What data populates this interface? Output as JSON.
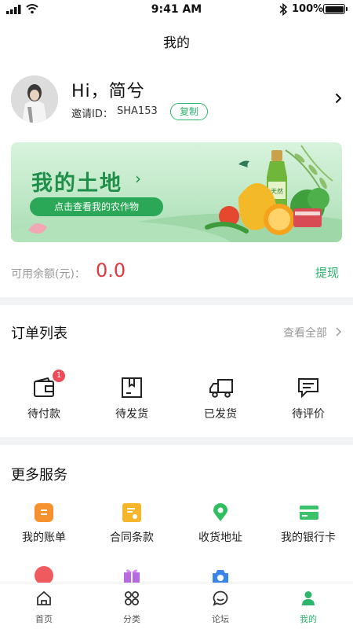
{
  "status_bar": {
    "time": "9:41 AM",
    "battery": "100%"
  },
  "nav": {
    "title": "我的"
  },
  "profile": {
    "greeting": "Hi，简兮",
    "invite_label": "邀请ID：",
    "invite_code": "SHA153",
    "copy_label": "复制"
  },
  "banner": {
    "title": "我的土地",
    "arrow": "›",
    "button_label": "点击查看我的农作物",
    "bottle_label": "天然"
  },
  "balance": {
    "label": "可用余额(元)：",
    "value": "0.0",
    "withdraw_label": "提现"
  },
  "orders": {
    "title": "订单列表",
    "view_all": "查看全部",
    "items": [
      {
        "label": "待付款",
        "icon": "wallet-icon",
        "badge": "1"
      },
      {
        "label": "待发货",
        "icon": "box-icon"
      },
      {
        "label": "已发货",
        "icon": "truck-icon"
      },
      {
        "label": "待评价",
        "icon": "comment-icon"
      }
    ]
  },
  "services": {
    "title": "更多服务",
    "items": [
      {
        "label": "我的账单",
        "icon": "bill-icon",
        "color": "#f5922f"
      },
      {
        "label": "合同条款",
        "icon": "contract-icon",
        "color": "#f7b52c"
      },
      {
        "label": "收货地址",
        "icon": "location-icon",
        "color": "#2fbf5f"
      },
      {
        "label": "我的银行卡",
        "icon": "bank-card-icon",
        "color": "#3cc26a"
      },
      {
        "icon": "service-icon",
        "color": "#ef5a5f"
      },
      {
        "icon": "gift-icon",
        "color": "#b86ae0"
      },
      {
        "icon": "camera-icon",
        "color": "#3a86e8"
      }
    ]
  },
  "tab_bar": {
    "active": "我的",
    "items": [
      {
        "label": "首页",
        "icon": "home-icon"
      },
      {
        "label": "分类",
        "icon": "category-icon"
      },
      {
        "label": "论坛",
        "icon": "forum-icon"
      },
      {
        "label": "我的",
        "icon": "profile-icon"
      }
    ]
  },
  "colors": {
    "accent": "#2db56b",
    "balance_value": "#e3363c",
    "badge": "#ec4c5a"
  }
}
